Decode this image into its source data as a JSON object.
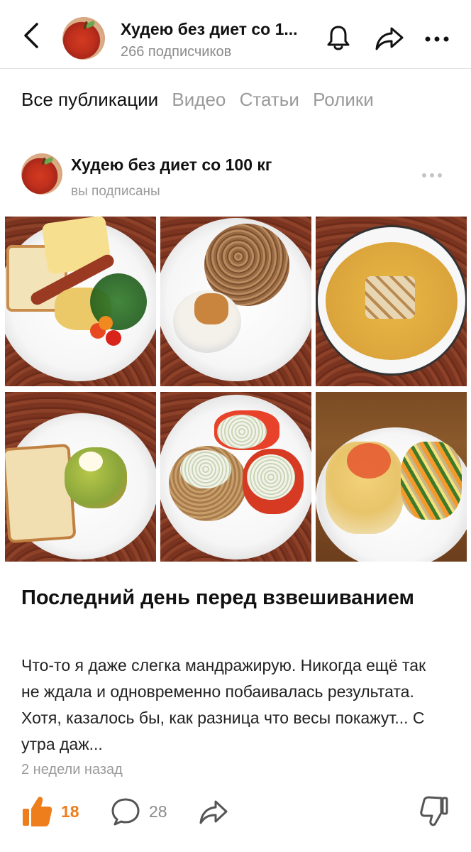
{
  "header": {
    "channel_title": "Худею без диет со 1...",
    "subscribers": "266 подписчиков"
  },
  "tabs": [
    {
      "label": "Все публикации",
      "active": true
    },
    {
      "label": "Видео",
      "active": false
    },
    {
      "label": "Статьи",
      "active": false
    },
    {
      "label": "Ролики",
      "active": false
    }
  ],
  "post": {
    "author": "Худею без диет со 100 кг",
    "subscription_status": "вы подписаны",
    "title": "Последний день перед взвешиванием",
    "excerpt": "Что-то я даже слегка мандражирую. Никогда ещё так не ждала и одновременно побаивалась результата.  Хотя, казалось бы, как разница что весы покажут...  С утра даж...",
    "time": "2 недели назад",
    "likes": "18",
    "comments": "28"
  },
  "icons": {
    "back": "back-arrow-icon",
    "bell": "bell-icon",
    "share": "share-arrow-icon",
    "more": "more-dots-icon",
    "like": "thumbs-up-icon",
    "comment": "comment-bubble-icon",
    "dislike": "thumbs-down-icon"
  },
  "colors": {
    "accent": "#ee7d1c",
    "muted": "#9a9a9a",
    "text": "#111111"
  }
}
